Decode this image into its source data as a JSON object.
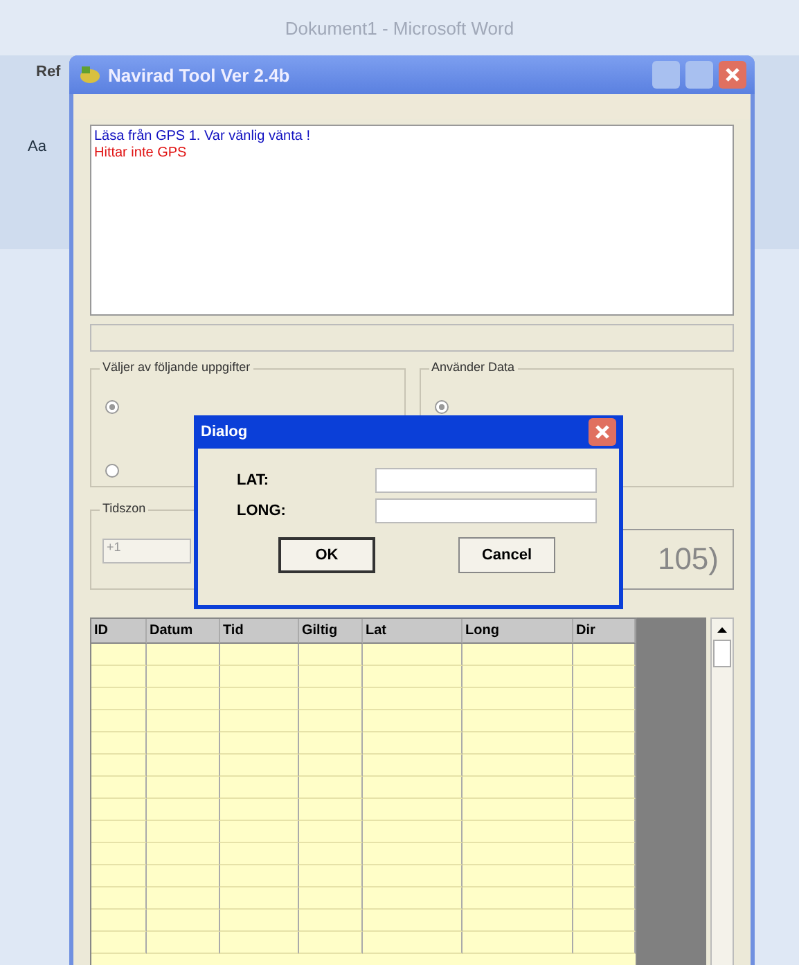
{
  "host_window": {
    "title": "Dokument1 - Microsoft Word",
    "ribbon_tab": "Ref",
    "ribbon_button": "Aa"
  },
  "window": {
    "title": "Navirad Tool Ver 2.4b"
  },
  "log": [
    {
      "text": "Läsa från GPS 1. Var vänlig vänta !",
      "color": "#1010c0"
    },
    {
      "text": "Hittar inte GPS",
      "color": "#e01010"
    }
  ],
  "groups": [
    {
      "title": "Väljer av följande uppgifter",
      "radios": [
        {
          "selected": true
        },
        {
          "selected": false
        }
      ]
    },
    {
      "title": "Använder Data",
      "radios": [
        {
          "selected": true
        }
      ]
    }
  ],
  "timezone": {
    "title": "Tidszon",
    "value": "+1"
  },
  "reading": "105)",
  "table": {
    "columns": [
      "ID",
      "Datum",
      "Tid",
      "Giltig",
      "Lat",
      "Long",
      "Dir"
    ]
  },
  "dialog": {
    "title": "Dialog",
    "fields": [
      {
        "label": "LAT:"
      },
      {
        "label": "LONG:"
      }
    ],
    "buttons": [
      {
        "label": "OK",
        "default": true
      },
      {
        "label": "Cancel",
        "default": false
      }
    ]
  }
}
